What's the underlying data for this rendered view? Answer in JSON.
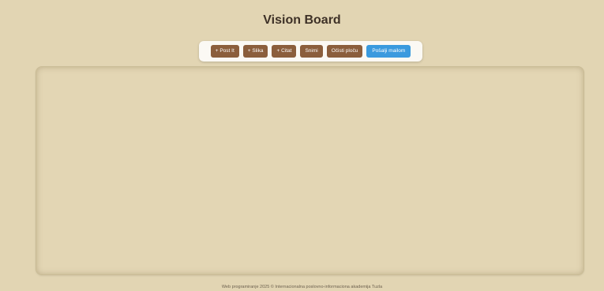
{
  "title": "Vision Board",
  "toolbar": {
    "buttons": [
      {
        "label": "+ Post It"
      },
      {
        "label": "+ Slika"
      },
      {
        "label": "+ Citat"
      },
      {
        "label": "Snimi"
      },
      {
        "label": "Očisti ploču"
      },
      {
        "label": "Pošalji mailom"
      }
    ]
  },
  "footer": {
    "text": "Web programiranje 2025 © Internacionalna poslovno-informaciona akademija Tuzla"
  },
  "colors": {
    "background": "#e2d5b3",
    "button_brown": "#8b5e3c",
    "button_blue": "#3a9ade"
  }
}
